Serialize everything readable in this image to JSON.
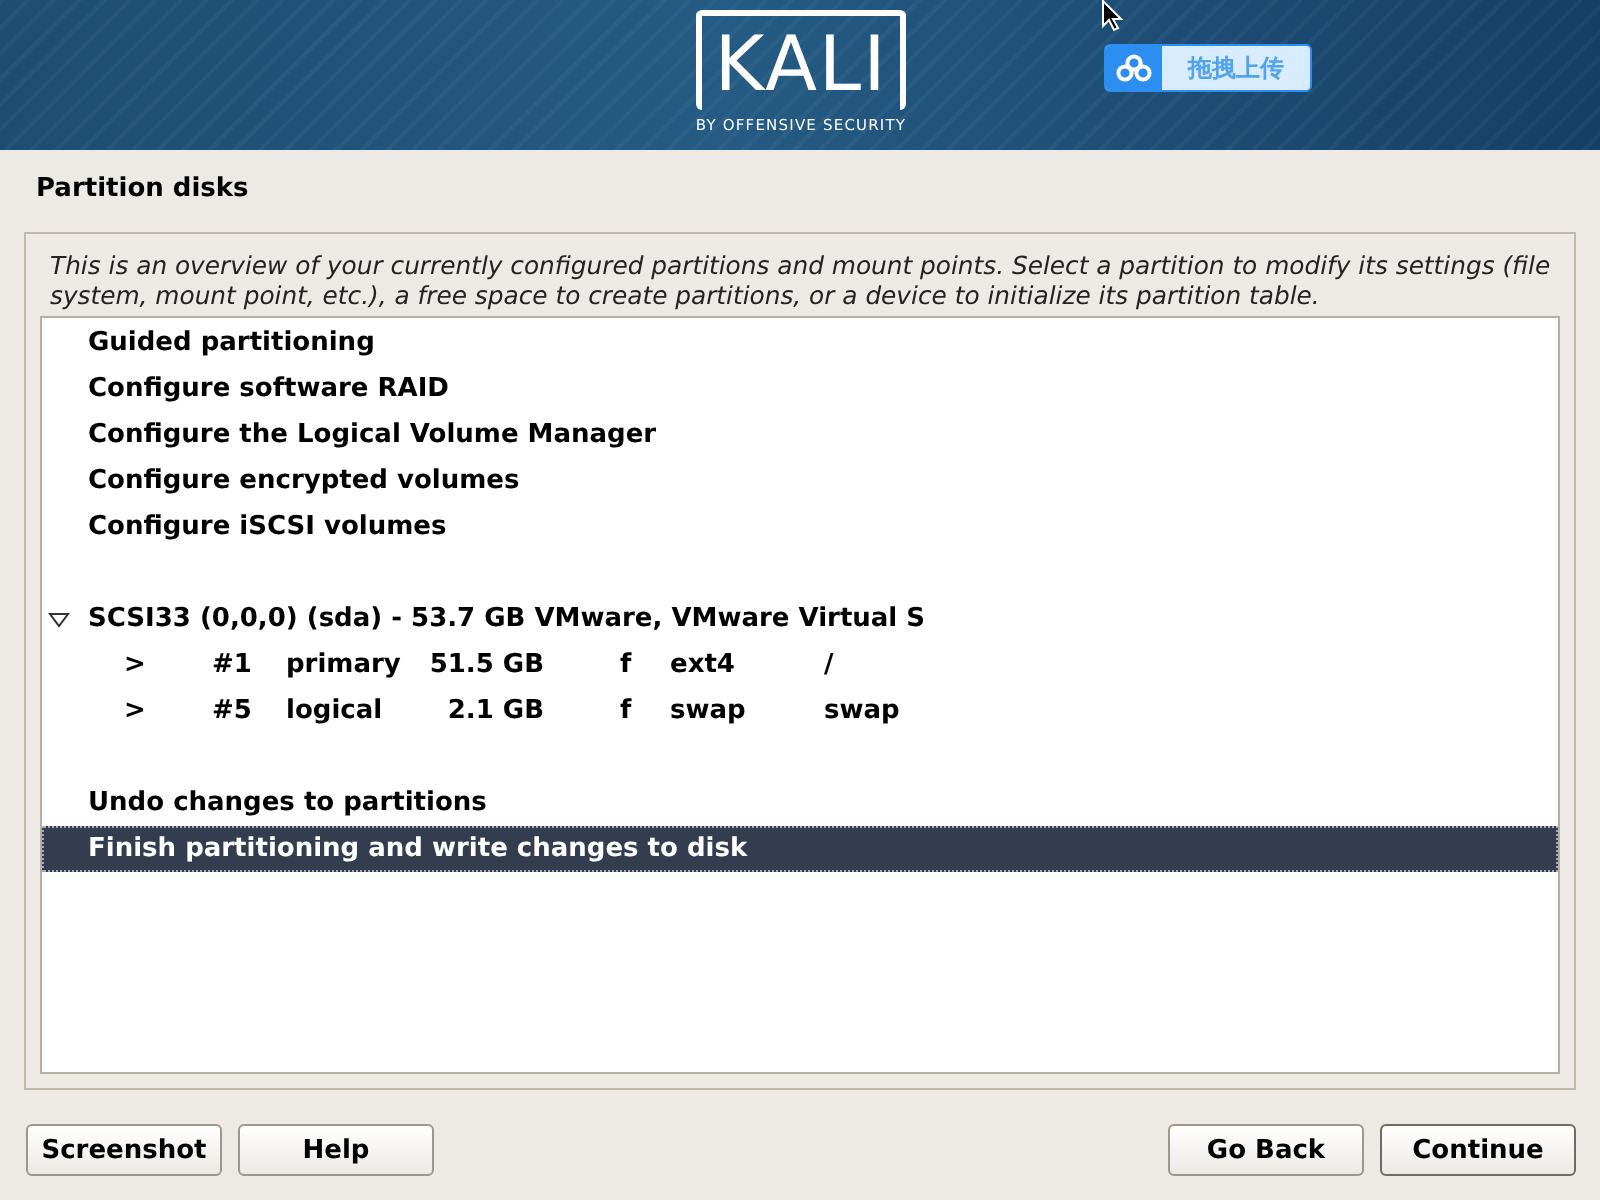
{
  "banner": {
    "logo": "KALI",
    "tagline": "BY OFFENSIVE SECURITY"
  },
  "upload_widget": {
    "label": "拖拽上传"
  },
  "title": "Partition disks",
  "description": "This is an overview of your currently configured partitions and mount points. Select a partition to modify its settings (file system, mount point, etc.), a free space to create partitions, or a device to initialize its partition table.",
  "sections": [
    {
      "items": [
        {
          "kind": "action",
          "label": "Guided partitioning",
          "selected": false
        },
        {
          "kind": "action",
          "label": "Configure software RAID",
          "selected": false
        },
        {
          "kind": "action",
          "label": "Configure the Logical Volume Manager",
          "selected": false
        },
        {
          "kind": "action",
          "label": "Configure encrypted volumes",
          "selected": false
        },
        {
          "kind": "action",
          "label": "Configure iSCSI volumes",
          "selected": false
        }
      ]
    },
    {
      "items": [
        {
          "kind": "disk",
          "label": "SCSI33 (0,0,0) (sda) - 53.7 GB VMware, VMware Virtual S",
          "expanded": true,
          "selected": false,
          "children": [
            {
              "kind": "partition",
              "marker": ">",
              "number": "#1",
              "type": "primary",
              "size": "51.5 GB",
              "flag": "f",
              "filesystem": "ext4",
              "mount": "/",
              "selected": false
            },
            {
              "kind": "partition",
              "marker": ">",
              "number": "#5",
              "type": "logical",
              "size": "2.1 GB",
              "flag": "f",
              "filesystem": "swap",
              "mount": "swap",
              "selected": false
            }
          ]
        }
      ]
    },
    {
      "items": [
        {
          "kind": "action",
          "label": "Undo changes to partitions",
          "selected": false
        },
        {
          "kind": "action",
          "label": "Finish partitioning and write changes to disk",
          "selected": true
        }
      ]
    }
  ],
  "buttons_left": [
    "Screenshot",
    "Help"
  ],
  "buttons_right": [
    "Go Back",
    "Continue"
  ]
}
